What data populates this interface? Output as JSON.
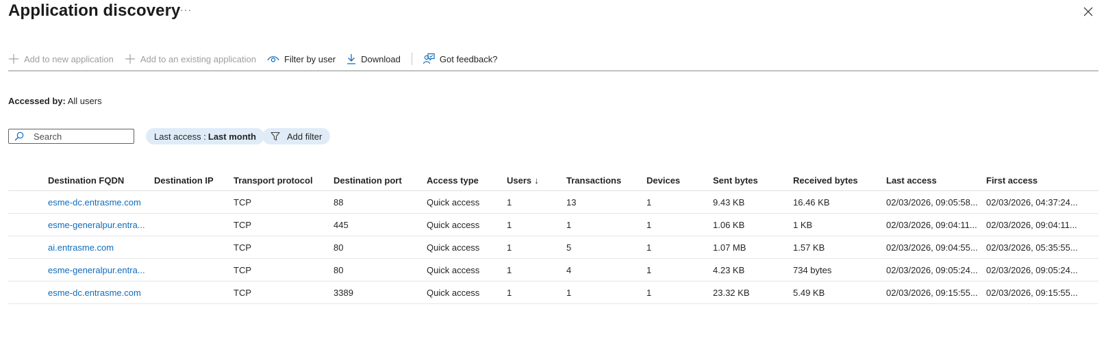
{
  "header": {
    "title": "Application discovery",
    "more_label": "···"
  },
  "toolbar": {
    "add_new_label": "Add to new application",
    "add_existing_label": "Add to an existing application",
    "filter_user_label": "Filter by user",
    "download_label": "Download",
    "feedback_label": "Got feedback?"
  },
  "accessed_by": {
    "label": "Accessed by:",
    "value": "All users"
  },
  "search": {
    "placeholder": "Search",
    "value": ""
  },
  "filters": {
    "last_access_label": "Last access :",
    "last_access_value": "Last month",
    "add_filter_label": "Add filter"
  },
  "table": {
    "columns": [
      "Destination FQDN",
      "Destination IP",
      "Transport protocol",
      "Destination port",
      "Access type",
      "Users",
      "Transactions",
      "Devices",
      "Sent bytes",
      "Received bytes",
      "Last access",
      "First access"
    ],
    "sort_indicator": "↓",
    "rows": [
      [
        "esme-dc.entrasme.com",
        "",
        "TCP",
        "88",
        "Quick access",
        "1",
        "13",
        "1",
        "9.43 KB",
        "16.46 KB",
        "02/03/2026, 09:05:58...",
        "02/03/2026, 04:37:24..."
      ],
      [
        "esme-generalpur.entra...",
        "",
        "TCP",
        "445",
        "Quick access",
        "1",
        "1",
        "1",
        "1.06 KB",
        "1 KB",
        "02/03/2026, 09:04:11...",
        "02/03/2026, 09:04:11..."
      ],
      [
        "ai.entrasme.com",
        "",
        "TCP",
        "80",
        "Quick access",
        "1",
        "5",
        "1",
        "1.07 MB",
        "1.57 KB",
        "02/03/2026, 09:04:55...",
        "02/03/2026, 05:35:55..."
      ],
      [
        "esme-generalpur.entra...",
        "",
        "TCP",
        "80",
        "Quick access",
        "1",
        "4",
        "1",
        "4.23 KB",
        "734 bytes",
        "02/03/2026, 09:05:24...",
        "02/03/2026, 09:05:24..."
      ],
      [
        "esme-dc.entrasme.com",
        "",
        "TCP",
        "3389",
        "Quick access",
        "1",
        "1",
        "1",
        "23.32 KB",
        "5.49 KB",
        "02/03/2026, 09:15:55...",
        "02/03/2026, 09:15:55..."
      ]
    ]
  },
  "icons": {
    "add": "plus-icon",
    "filter_user": "eye-icon",
    "download": "download-icon",
    "feedback": "feedback-icon",
    "search": "search-icon",
    "filter": "funnel-icon",
    "close": "close-icon"
  },
  "colors": {
    "link": "#0f6cbd",
    "pill_bg": "#dfecf8",
    "accent_icon": "#0f6cbd"
  }
}
